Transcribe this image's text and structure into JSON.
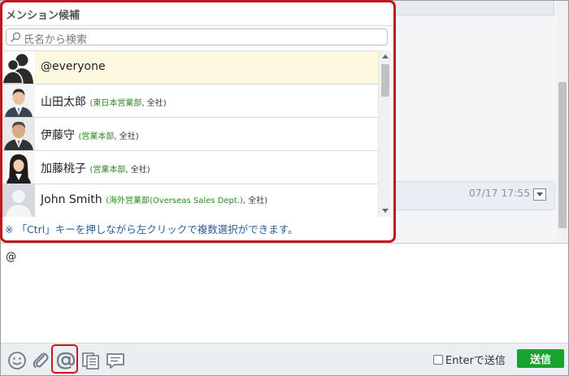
{
  "popup": {
    "title": "メンション候補",
    "search_placeholder": "氏名から検索",
    "hint": "※ 「Ctrl」キーを押しながら左クリックで複数選択ができます。",
    "candidates": [
      {
        "name": "@everyone",
        "org": "",
        "company": "",
        "avatar": "group-icon",
        "selected": true
      },
      {
        "name": "山田太郎",
        "org": "東日本営業部",
        "company": "全社",
        "avatar": "person-photo"
      },
      {
        "name": "伊藤守",
        "org": "営業本部",
        "company": "全社",
        "avatar": "person-photo"
      },
      {
        "name": "加藤桃子",
        "org": "営業本部",
        "company": "全社",
        "avatar": "person-photo"
      },
      {
        "name": "John Smith",
        "org": "海外営業部(Overseas Sales Dept.)",
        "company": "全社",
        "avatar": "default-avatar-icon"
      }
    ]
  },
  "chat": {
    "message_time": "07/17 17:55"
  },
  "composer": {
    "input_value": "@",
    "enter_to_send_label": "Enterで送信",
    "enter_to_send_checked": false,
    "send_label": "送信"
  },
  "toolbar": {
    "icons": [
      "emoji-icon",
      "attachment-icon",
      "mention-icon",
      "template-icon",
      "stamp-icon"
    ]
  },
  "colors": {
    "highlight_border": "#c4141c",
    "send_button": "#18a330",
    "selected_row": "#fdf8df",
    "org_text": "#2a8a1e",
    "hint_text": "#2b5d96"
  }
}
